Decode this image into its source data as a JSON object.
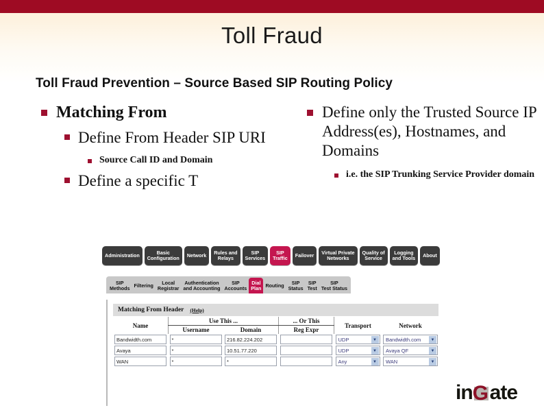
{
  "slide": {
    "title": "Toll Fraud",
    "subtitle": "Toll Fraud Prevention – Source Based SIP Routing Policy",
    "accent_red": "#9e0b23",
    "bullet_red": "#9e1030"
  },
  "bullets_left": [
    {
      "level": 1,
      "text": "Matching From"
    },
    {
      "level": 2,
      "text": "Define From Header SIP URI"
    },
    {
      "level": 3,
      "text": "Source Call ID and Domain"
    },
    {
      "level": 2,
      "text": "Define a specific T"
    }
  ],
  "bullets_right": [
    {
      "level": 1,
      "text": "Define only the Trusted Source IP Address(es), Hostnames, and Domains"
    },
    {
      "level": 3,
      "text": "i.e. the SIP Trunking Service Provider domain"
    }
  ],
  "admin_gui": {
    "primary_tabs": [
      {
        "label": "Administration",
        "selected": false
      },
      {
        "label": "Basic\nConfiguration",
        "selected": false
      },
      {
        "label": "Network",
        "selected": false
      },
      {
        "label": "Rules and\nRelays",
        "selected": false
      },
      {
        "label": "SIP\nServices",
        "selected": false
      },
      {
        "label": "SIP\nTraffic",
        "selected": true
      },
      {
        "label": "Failover",
        "selected": false
      },
      {
        "label": "Virtual Private\nNetworks",
        "selected": false
      },
      {
        "label": "Quality of\nService",
        "selected": false
      },
      {
        "label": "Logging\nand Tools",
        "selected": false
      },
      {
        "label": "About",
        "selected": false
      }
    ],
    "secondary_tabs": [
      {
        "label": "SIP\nMethods",
        "selected": false
      },
      {
        "label": "Filtering",
        "selected": false
      },
      {
        "label": "Local\nRegistrar",
        "selected": false
      },
      {
        "label": "Authentication\nand Accounting",
        "selected": false
      },
      {
        "label": "SIP\nAccounts",
        "selected": false
      },
      {
        "label": "Dial\nPlan",
        "selected": true
      },
      {
        "label": "Routing",
        "selected": false
      },
      {
        "label": "SIP\nStatus",
        "selected": false
      },
      {
        "label": "SIP\nTest",
        "selected": false
      },
      {
        "label": "SIP\nTest Status",
        "selected": false
      }
    ],
    "panel": {
      "heading": "Matching From Header",
      "help_link": "(Help)",
      "group_headers": {
        "use_this": "Use This ...",
        "or_this": "... Or This"
      },
      "columns": [
        "Name",
        "Username",
        "Domain",
        "Reg Expr",
        "Transport",
        "Network"
      ],
      "rows": [
        {
          "name": "Bandwidth.com",
          "username": "*",
          "domain": "216.82.224.202",
          "reg_expr": "",
          "transport": "UDP",
          "network": "Bandwidth.com"
        },
        {
          "name": "Avaya",
          "username": "*",
          "domain": "10.51.77.220",
          "reg_expr": "",
          "transport": "UDP",
          "network": "Avaya QF"
        },
        {
          "name": "WAN",
          "username": "*",
          "domain": "*",
          "reg_expr": "",
          "transport": "Any",
          "network": "WAN"
        }
      ]
    }
  },
  "logo": {
    "part1": "in",
    "part2": "G",
    "part3": "ate"
  }
}
